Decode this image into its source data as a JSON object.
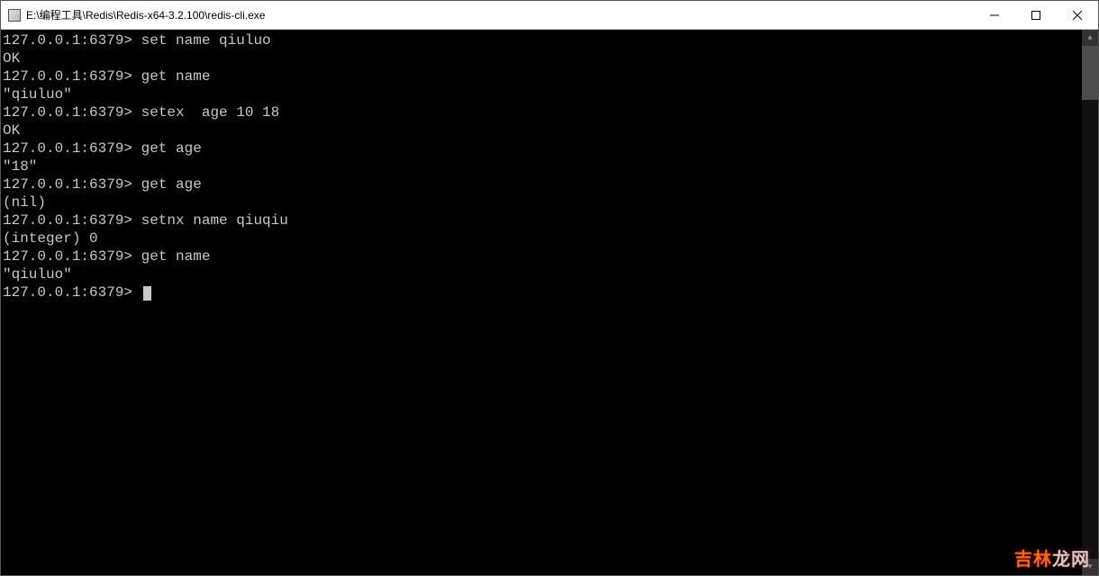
{
  "window": {
    "title": "E:\\编程工具\\Redis\\Redis-x64-3.2.100\\redis-cli.exe"
  },
  "terminal": {
    "prompt": "127.0.0.1:6379>",
    "lines": [
      {
        "type": "cmd",
        "text": "set name qiuluo"
      },
      {
        "type": "out",
        "text": "OK"
      },
      {
        "type": "cmd",
        "text": "get name"
      },
      {
        "type": "out",
        "text": "\"qiuluo\""
      },
      {
        "type": "cmd",
        "text": "setex  age 10 18"
      },
      {
        "type": "out",
        "text": "OK"
      },
      {
        "type": "cmd",
        "text": "get age"
      },
      {
        "type": "out",
        "text": "\"18\""
      },
      {
        "type": "cmd",
        "text": "get age"
      },
      {
        "type": "out",
        "text": "(nil)"
      },
      {
        "type": "cmd",
        "text": "setnx name qiuqiu"
      },
      {
        "type": "out",
        "text": "(integer) 0"
      },
      {
        "type": "cmd",
        "text": "get name"
      },
      {
        "type": "out",
        "text": "\"qiuluo\""
      },
      {
        "type": "cursor",
        "text": ""
      }
    ]
  },
  "watermark": {
    "part1": "吉林",
    "part2": "龙网"
  }
}
